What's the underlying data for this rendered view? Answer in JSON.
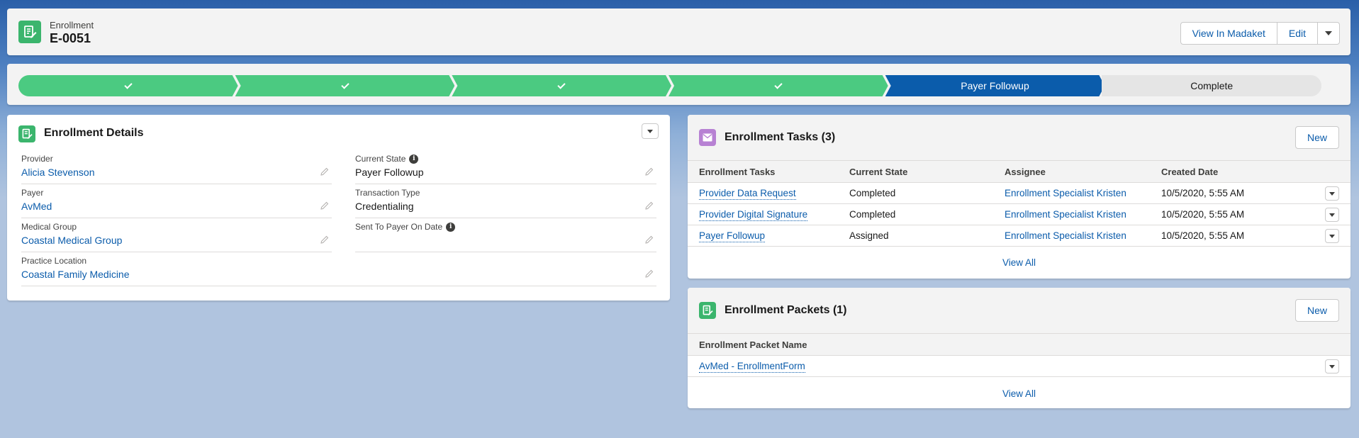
{
  "header": {
    "object_label": "Enrollment",
    "record_name": "E-0051",
    "buttons": {
      "view_in_madaket": "View In Madaket",
      "edit": "Edit"
    }
  },
  "path": {
    "steps": [
      {
        "label": "",
        "status": "done"
      },
      {
        "label": "",
        "status": "done"
      },
      {
        "label": "",
        "status": "done"
      },
      {
        "label": "",
        "status": "done"
      },
      {
        "label": "Payer Followup",
        "status": "current"
      },
      {
        "label": "Complete",
        "status": "todo"
      }
    ]
  },
  "details": {
    "title": "Enrollment Details",
    "fields": {
      "provider": {
        "label": "Provider",
        "value": "Alicia Stevenson"
      },
      "current_state": {
        "label": "Current State",
        "value": "Payer Followup"
      },
      "payer": {
        "label": "Payer",
        "value": "AvMed"
      },
      "transaction_type": {
        "label": "Transaction Type",
        "value": "Credentialing"
      },
      "medical_group": {
        "label": "Medical Group",
        "value": "Coastal Medical Group"
      },
      "sent_to_payer_on_date": {
        "label": "Sent To Payer On Date",
        "value": ""
      },
      "practice_location": {
        "label": "Practice Location",
        "value": "Coastal Family Medicine"
      }
    }
  },
  "tasks": {
    "title": "Enrollment Tasks (3)",
    "new_label": "New",
    "columns": [
      "Enrollment Tasks",
      "Current State",
      "Assignee",
      "Created Date"
    ],
    "rows": [
      {
        "task": "Provider Data Request",
        "state": "Completed",
        "assignee": "Enrollment Specialist Kristen",
        "created": "10/5/2020, 5:55 AM"
      },
      {
        "task": "Provider Digital Signature",
        "state": "Completed",
        "assignee": "Enrollment Specialist Kristen",
        "created": "10/5/2020, 5:55 AM"
      },
      {
        "task": "Payer Followup",
        "state": "Assigned",
        "assignee": "Enrollment Specialist Kristen",
        "created": "10/5/2020, 5:55 AM"
      }
    ],
    "view_all": "View All"
  },
  "packets": {
    "title": "Enrollment Packets (1)",
    "new_label": "New",
    "columns": [
      "Enrollment Packet Name"
    ],
    "rows": [
      {
        "name": "AvMed - EnrollmentForm"
      }
    ],
    "view_all": "View All"
  },
  "icons": {
    "record_icon": "document-edit-icon",
    "tasks_icon": "envelope-icon",
    "packets_icon": "document-edit-icon",
    "info_icon": "info-icon",
    "edit_icon": "pencil-icon",
    "check_icon": "check-icon"
  },
  "colors": {
    "brand_blue": "#0b5cab",
    "complete_green": "#4bca81",
    "record_icon_green": "#3bb56d",
    "tasks_icon_purple": "#b781d3"
  }
}
